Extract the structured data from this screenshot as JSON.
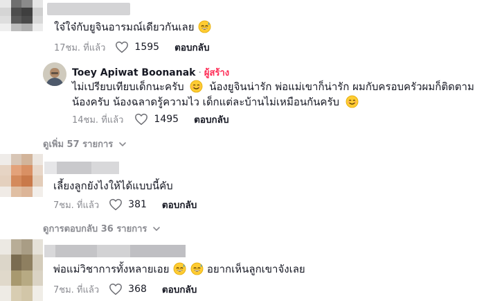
{
  "comments": [
    {
      "text": "ใจ๋ใจ๋กับยูจินอารมณ์เดียวกันเลย",
      "emoji": "grinning-sweat-face",
      "time": "17ชม. ที่แล้ว",
      "likes": "1595",
      "reply_label": "ตอบกลับ"
    },
    {
      "text": "เลี้ยงลูกยังไงให้ได้แบบนี้คับ",
      "time": "7ชม. ที่แล้ว",
      "likes": "381",
      "reply_label": "ตอบกลับ"
    },
    {
      "text_a": "พ่อแม่วิชาการทั้งหลายเอย",
      "text_b": "อยากเห็นลูกเขาจังเลย",
      "time": "7ชม. ที่แล้ว",
      "likes": "368",
      "reply_label": "ตอบกลับ"
    }
  ],
  "author_reply": {
    "name": "Toey Apiwat Boonanak",
    "separator": "·",
    "badge": "ผู้สร้าง",
    "line1": "ไม่เปรียบเทียบเด็กนะครับ",
    "line1b": "น้องยูจินน่ารัก พ่อแม่เขาก็น่ารัก ผมกับครอบครัวผมก็ติดตาม",
    "line2": "น้องครับ น้องฉลาดรู้ความไว เด็กแต่ละบ้านไม่เหมือนกันครับ",
    "time": "14ชม. ที่แล้ว",
    "likes": "1495",
    "reply_label": "ตอบกลับ"
  },
  "expanders": {
    "more_replies": "ดูเพิ่ม 57 รายการ",
    "view_replies": "ดูการตอบกลับ 36 รายการ"
  },
  "colors": {
    "creator_badge": "#fe2c55",
    "muted": "#8a8b91",
    "text": "#161823"
  }
}
